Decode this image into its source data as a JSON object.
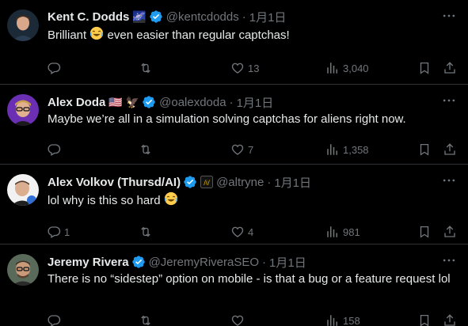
{
  "tweets": [
    {
      "name": "Kent C. Dodds",
      "name_emoji": "🌌",
      "handle": "@kentcdodds",
      "time": "1月1日",
      "text_before": "Brilliant",
      "text_after": "even easier than regular captchas!",
      "reply_count": "",
      "repost_count": "",
      "like_count": "13",
      "view_count": "3,040"
    },
    {
      "name": "Alex Doda",
      "name_emoji": "🇺🇸 🦅",
      "handle": "@oalexdoda",
      "time": "1月1日",
      "text": "Maybe we’re all in a simulation solving captchas for aliens right now.",
      "reply_count": "",
      "repost_count": "",
      "like_count": "7",
      "view_count": "1,358"
    },
    {
      "name": "Alex Volkov (Thursd/AI)",
      "handle": "@altryne",
      "time": "1月1日",
      "text": "lol why is this so hard",
      "reply_count": "1",
      "repost_count": "",
      "like_count": "4",
      "view_count": "981"
    },
    {
      "name": "Jeremy Rivera",
      "handle": "@JeremyRiveraSEO",
      "time": "1月1日",
      "text": "There is no “sidestep” option on mobile - is that a bug or a feature request lol",
      "reply_count": "",
      "repost_count": "",
      "like_count": "",
      "view_count": "158"
    }
  ],
  "colors": {
    "background": "#000000",
    "text": "#e7e9ea",
    "muted": "#71767b",
    "verified": "#1d9bf0",
    "divider": "#2f3336"
  }
}
